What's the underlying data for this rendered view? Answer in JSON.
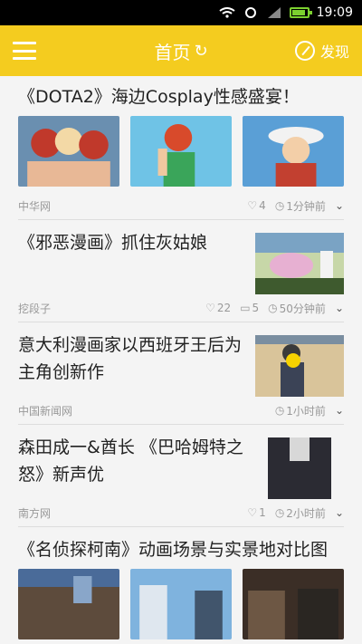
{
  "status": {
    "time": "19:09"
  },
  "header": {
    "title": "首页",
    "refresh_glyph": "↻",
    "discover_label": "发现"
  },
  "articles": [
    {
      "title": "《DOTA2》海边Cosplay性感盛宴！",
      "source": "中华网",
      "likes": "4",
      "time": "1分钟前"
    },
    {
      "title": "《邪恶漫画》抓住灰姑娘",
      "source": "挖段子",
      "likes": "22",
      "comments": "5",
      "time": "50分钟前"
    },
    {
      "title": "意大利漫画家以西班牙王后为主角创新作",
      "source": "中国新闻网",
      "time": "1小时前"
    },
    {
      "title": "森田成一&酋长 《巴哈姆特之怒》新声优",
      "source": "南方网",
      "likes": "1",
      "time": "2小时前"
    },
    {
      "title": "《名侦探柯南》动画场景与实景地对比图"
    }
  ],
  "icons": {
    "like": "heart-icon",
    "comment": "comment-icon",
    "clock": "clock-icon",
    "more": "chevron-down-icon"
  }
}
